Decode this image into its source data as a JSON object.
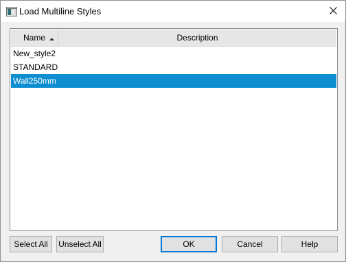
{
  "window": {
    "title": "Load Multiline Styles",
    "icon": "app-window-icon",
    "close_icon": "close-icon"
  },
  "list": {
    "columns": [
      {
        "label": "Name",
        "sort": "ascending"
      },
      {
        "label": "Description"
      }
    ],
    "rows": [
      {
        "name": "New_style2",
        "description": "",
        "selected": false
      },
      {
        "name": "STANDARD",
        "description": "",
        "selected": false
      },
      {
        "name": "Wall250mm",
        "description": "",
        "selected": true
      }
    ],
    "selection_color": "#0c8ed1"
  },
  "buttons": {
    "select_all": "Select All",
    "unselect_all": "Unselect All",
    "ok": "OK",
    "cancel": "Cancel",
    "help": "Help"
  }
}
